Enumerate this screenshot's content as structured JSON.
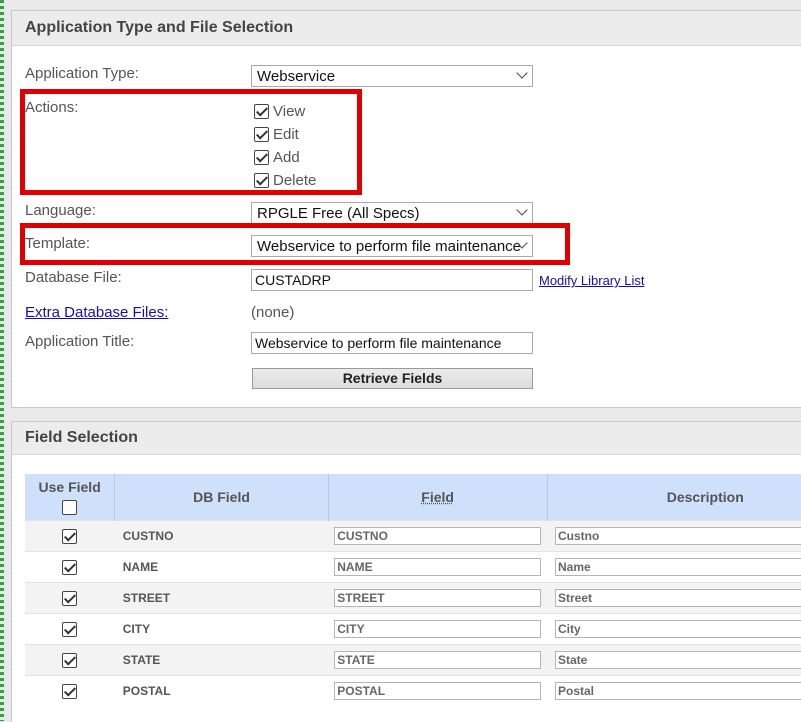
{
  "app_section": {
    "title": "Application Type and File Selection",
    "app_type_label": "Application Type:",
    "app_type_value": "Webservice",
    "actions_label": "Actions:",
    "actions": [
      {
        "label": "View",
        "checked": true
      },
      {
        "label": "Edit",
        "checked": true
      },
      {
        "label": "Add",
        "checked": true
      },
      {
        "label": "Delete",
        "checked": true
      }
    ],
    "language_label": "Language:",
    "language_value": "RPGLE Free (All Specs)",
    "template_label": "Template:",
    "template_value": "Webservice to perform file maintenance",
    "database_file_label": "Database File:",
    "database_file_value": "CUSTADRP",
    "modify_library_link": "Modify Library List",
    "extra_files_label": "Extra Database Files:",
    "extra_files_value": "(none)",
    "app_title_label": "Application Title:",
    "app_title_value": "Webservice to perform file maintenance",
    "retrieve_button": "Retrieve Fields"
  },
  "field_section": {
    "title": "Field Selection",
    "columns": {
      "use_field": "Use Field",
      "db_field": "DB Field",
      "field": "Field",
      "description": "Description"
    },
    "rows": [
      {
        "db": "CUSTNO",
        "field": "CUSTNO",
        "desc": "Custno",
        "checked": true
      },
      {
        "db": "NAME",
        "field": "NAME",
        "desc": "Name",
        "checked": true
      },
      {
        "db": "STREET",
        "field": "STREET",
        "desc": "Street",
        "checked": true
      },
      {
        "db": "CITY",
        "field": "CITY",
        "desc": "City",
        "checked": true
      },
      {
        "db": "STATE",
        "field": "STATE",
        "desc": "State",
        "checked": true
      },
      {
        "db": "POSTAL",
        "field": "POSTAL",
        "desc": "Postal",
        "checked": true
      }
    ]
  },
  "colors": {
    "highlight": "#e00000",
    "header_blue": "#cfe0fb",
    "link": "#1a0dab"
  }
}
